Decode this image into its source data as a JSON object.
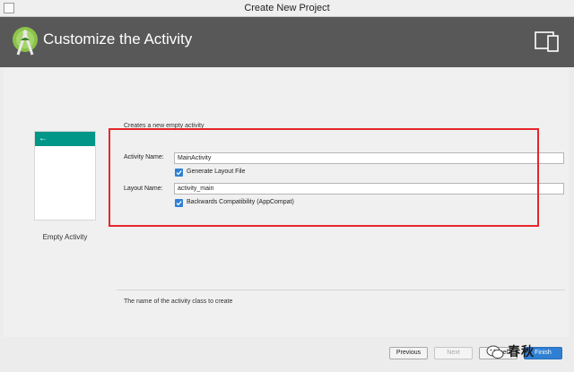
{
  "window": {
    "title": "Create New Project"
  },
  "header": {
    "title": "Customize the Activity",
    "logo_icon": "android-studio-logo",
    "device_icon": "tablet-icon"
  },
  "template": {
    "name": "Empty Activity",
    "back_icon": "←"
  },
  "form": {
    "description": "Creates a new empty activity",
    "activity_name_label": "Activity Name:",
    "activity_name_value": "MainActivity",
    "generate_layout_label": "Generate Layout File",
    "generate_layout_checked": true,
    "layout_name_label": "Layout Name:",
    "layout_name_value": "activity_main",
    "backwards_compat_label": "Backwards Compatibility (AppCompat)",
    "backwards_compat_checked": true
  },
  "hint": "The name of the activity class to create",
  "buttons": {
    "previous": "Previous",
    "next": "Next",
    "cancel": "Cancel",
    "finish": "Finish"
  },
  "watermark": {
    "text": "春秋"
  },
  "colors": {
    "header_bg": "#585858",
    "accent": "#009688",
    "checkbox": "#2f7fd3",
    "highlight": "#e6262b"
  }
}
